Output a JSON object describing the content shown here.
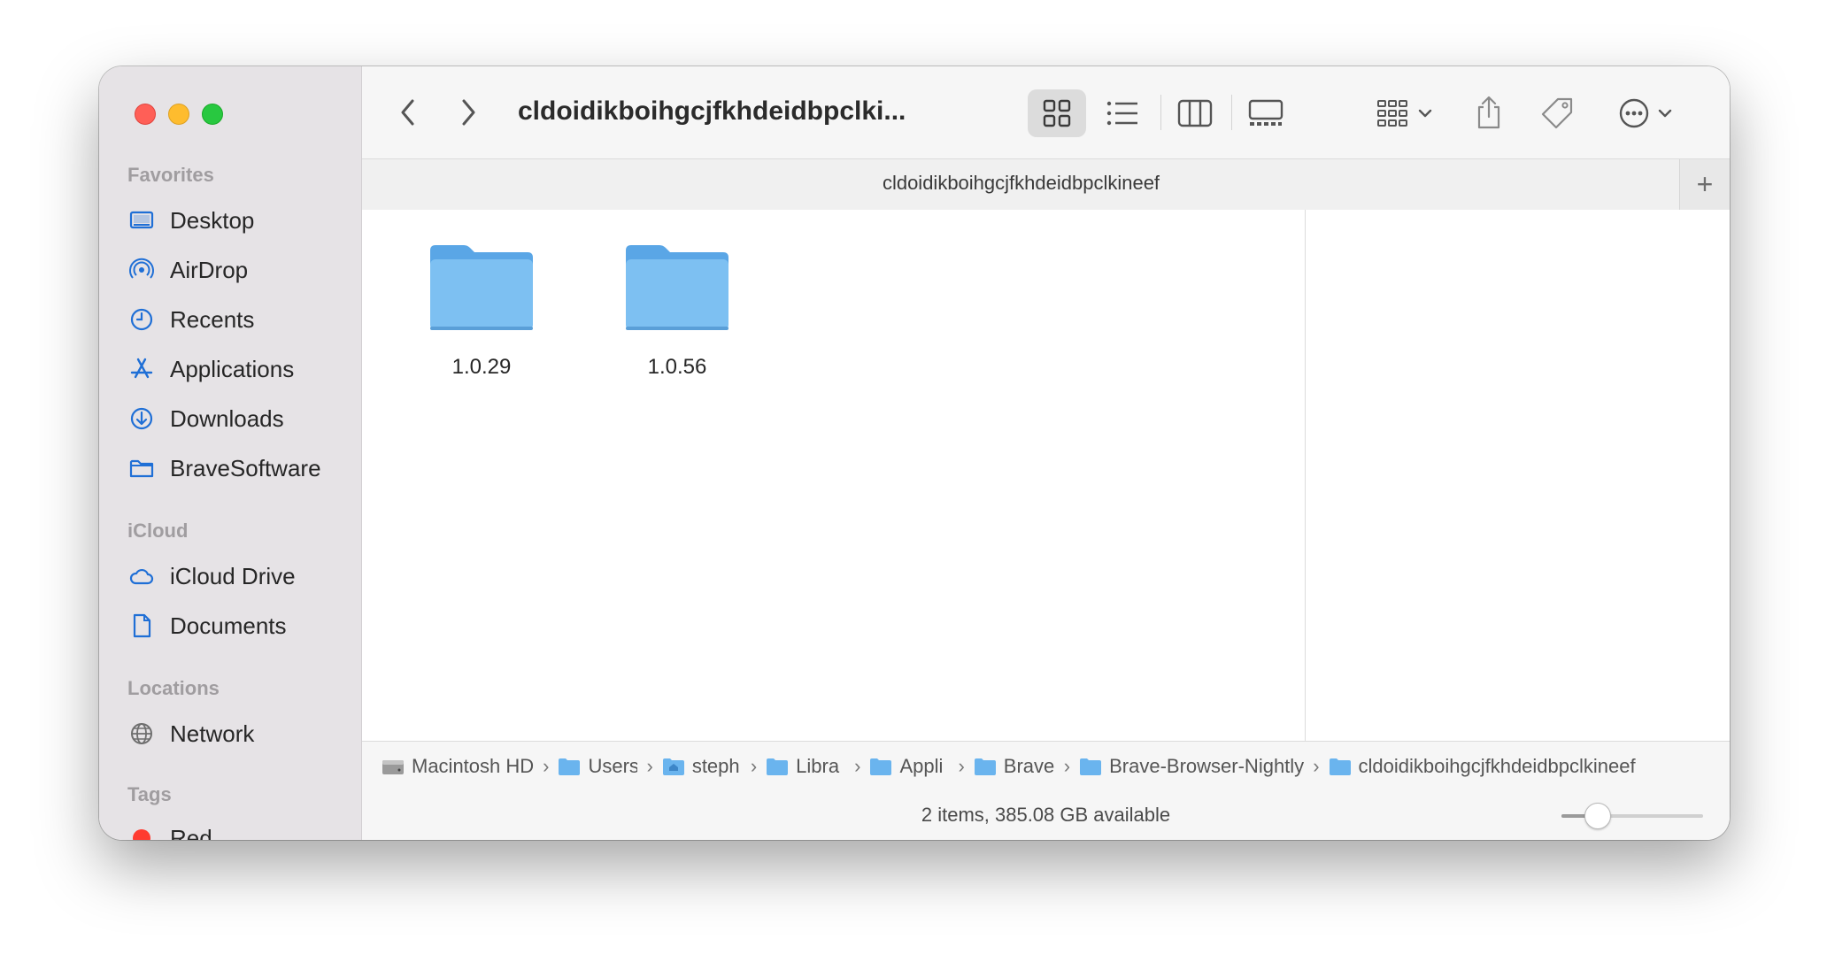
{
  "window": {
    "title": "cldoidikboihgcjfkhdeidbpclki..."
  },
  "sidebar": {
    "favorites_label": "Favorites",
    "favorites": [
      {
        "label": "Desktop",
        "icon": "desktop-icon"
      },
      {
        "label": "AirDrop",
        "icon": "airdrop-icon"
      },
      {
        "label": "Recents",
        "icon": "clock-icon"
      },
      {
        "label": "Applications",
        "icon": "applications-icon"
      },
      {
        "label": "Downloads",
        "icon": "download-icon"
      },
      {
        "label": "BraveSoftware",
        "icon": "folder-icon"
      }
    ],
    "icloud_label": "iCloud",
    "icloud": [
      {
        "label": "iCloud Drive",
        "icon": "cloud-icon"
      },
      {
        "label": "Documents",
        "icon": "document-icon"
      }
    ],
    "locations_label": "Locations",
    "locations": [
      {
        "label": "Network",
        "icon": "globe-icon"
      }
    ],
    "tags_label": "Tags",
    "tags": [
      {
        "label": "Red",
        "color": "#ff3b30"
      }
    ]
  },
  "tab": {
    "title": "cldoidikboihgcjfkhdeidbpclkineef",
    "plus": "+"
  },
  "items": [
    {
      "name": "1.0.29"
    },
    {
      "name": "1.0.56"
    }
  ],
  "pathbar": [
    {
      "label": "Macintosh HD",
      "icon": "drive-icon"
    },
    {
      "label": "Users",
      "icon": "folder-icon"
    },
    {
      "label": "steph",
      "icon": "home-folder-icon"
    },
    {
      "label": "Libra",
      "icon": "folder-icon"
    },
    {
      "label": "Appli",
      "icon": "folder-icon"
    },
    {
      "label": "Brave",
      "icon": "folder-icon"
    },
    {
      "label": "Brave-Browser-Nightly",
      "icon": "folder-icon"
    },
    {
      "label": "cldoidikboihgcjfkhdeidbpclkineef",
      "icon": "folder-icon"
    }
  ],
  "status": {
    "text": "2 items, 385.08 GB available",
    "zoom_level": 0.25
  },
  "colors": {
    "accent": "#1f6fd6",
    "folder": "#7dc0f2",
    "folder_tab": "#5aa6e6"
  }
}
